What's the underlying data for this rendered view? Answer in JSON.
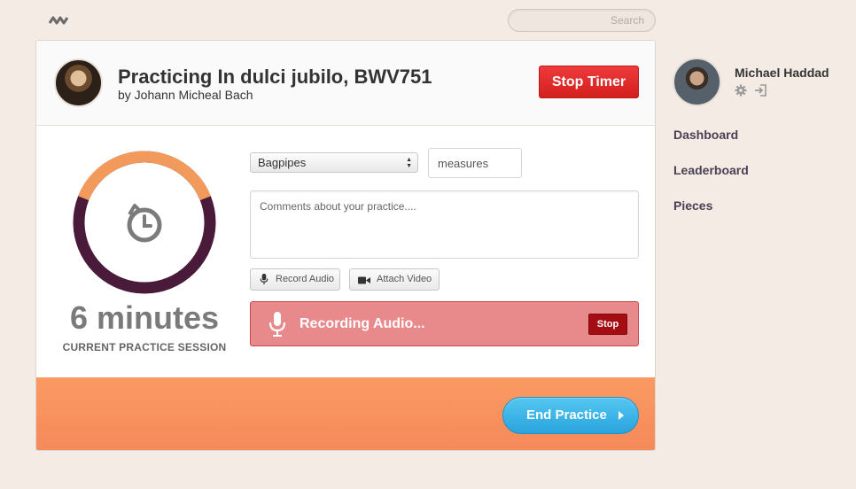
{
  "search": {
    "placeholder": "Search"
  },
  "header": {
    "title": "Practicing In dulci jubilo, BWV751",
    "composer": "by Johann Micheal Bach",
    "stop_timer_label": "Stop Timer"
  },
  "timer": {
    "value": "6 minutes",
    "caption": "CURRENT PRACTICE SESSION",
    "elapsed_fraction": 0.38,
    "colors": {
      "elapsed": "#f29a5c",
      "remaining": "#4a1a3a"
    }
  },
  "form": {
    "instrument": "Bagpipes",
    "measures_placeholder": "measures",
    "comments_placeholder": "Comments about your practice....",
    "record_audio_label": "Record Audio",
    "attach_video_label": "Attach Video"
  },
  "recording": {
    "label": "Recording Audio...",
    "stop_label": "Stop"
  },
  "footer": {
    "end_practice_label": "End Practice"
  },
  "user": {
    "name": "Michael Haddad"
  },
  "nav": {
    "items": [
      {
        "label": "Dashboard"
      },
      {
        "label": "Leaderboard"
      },
      {
        "label": "Pieces"
      }
    ]
  },
  "colors": {
    "background": "#f3ebe4",
    "stop_red": "#e52b2b",
    "recording_bg": "#e8898c",
    "footer_orange": "#f7905d",
    "end_blue": "#3bb4e9"
  }
}
